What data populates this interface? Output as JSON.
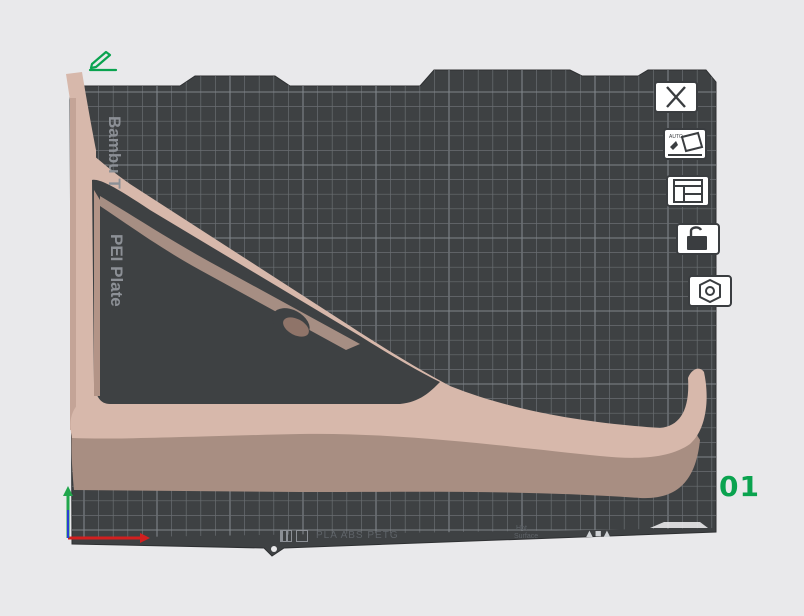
{
  "viewport": {
    "plate_labels": {
      "brand": "Bambu T",
      "plate_type": "PEI Plate"
    },
    "plate_number": "01",
    "bottom_strip": {
      "materials": "PLA ABS PETG",
      "note_line1": "Hot",
      "note_line2": "Surface"
    }
  },
  "plate_toolbar": [
    {
      "name": "close-plate-button",
      "icon": "x-icon"
    },
    {
      "name": "auto-arrange-button",
      "icon": "auto-orient-icon"
    },
    {
      "name": "arrange-button",
      "icon": "layout-icon"
    },
    {
      "name": "lock-plate-button",
      "icon": "unlock-icon"
    },
    {
      "name": "plate-settings-button",
      "icon": "hexagon-nut-icon"
    }
  ],
  "colors": {
    "background": "#e9e9eb",
    "bed": "#3e4143",
    "grid": "#6a6e72",
    "grid_major": "#80858a",
    "model": "#d7b8ab",
    "model_shadow": "#a88e82",
    "accent_green": "#0aa34f",
    "axis_x": "#d21f1f",
    "axis_y": "#21a64c",
    "axis_z": "#2b3cd6"
  }
}
